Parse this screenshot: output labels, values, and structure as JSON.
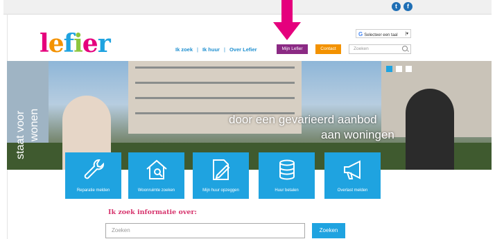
{
  "logo": {
    "text_letters": [
      "l",
      "e",
      "f",
      "i",
      "e",
      "r"
    ],
    "colors": [
      "#e5007d",
      "#f39200",
      "#1fa3e0",
      "#8dc63f",
      "#e5007d",
      "#1fa3e0"
    ]
  },
  "translate": {
    "label": "Selecteer een taal"
  },
  "nav": {
    "items": [
      "Ik zoek",
      "Ik huur",
      "Over Lefier"
    ],
    "mijn_lefier": "Mijn Lefier",
    "contact": "Contact"
  },
  "top_search": {
    "placeholder": "Zoeken"
  },
  "hero": {
    "vertical_text_line1": "staat voor",
    "vertical_text_line2": "wonen",
    "tagline_line1": "door een gevarieerd aanbod",
    "tagline_line2": "aan woningen",
    "slide_count": 3
  },
  "tiles": [
    {
      "label": "Reparatie melden",
      "icon": "wrench-icon"
    },
    {
      "label": "Woonruimte zoeken",
      "icon": "house-search-icon"
    },
    {
      "label": "Mijn huur opzeggen",
      "icon": "document-pen-icon"
    },
    {
      "label": "Huur betalen",
      "icon": "coins-icon"
    },
    {
      "label": "Overlast melden",
      "icon": "megaphone-icon"
    }
  ],
  "info": {
    "heading": "Ik zoek informatie over:",
    "search_placeholder": "Zoeken",
    "search_button": "Zoeken"
  },
  "colors": {
    "blue": "#1fa3e0",
    "purple": "#8b2a84",
    "orange": "#f39200",
    "pink": "#e5007d",
    "arrow": "#e5007d"
  }
}
